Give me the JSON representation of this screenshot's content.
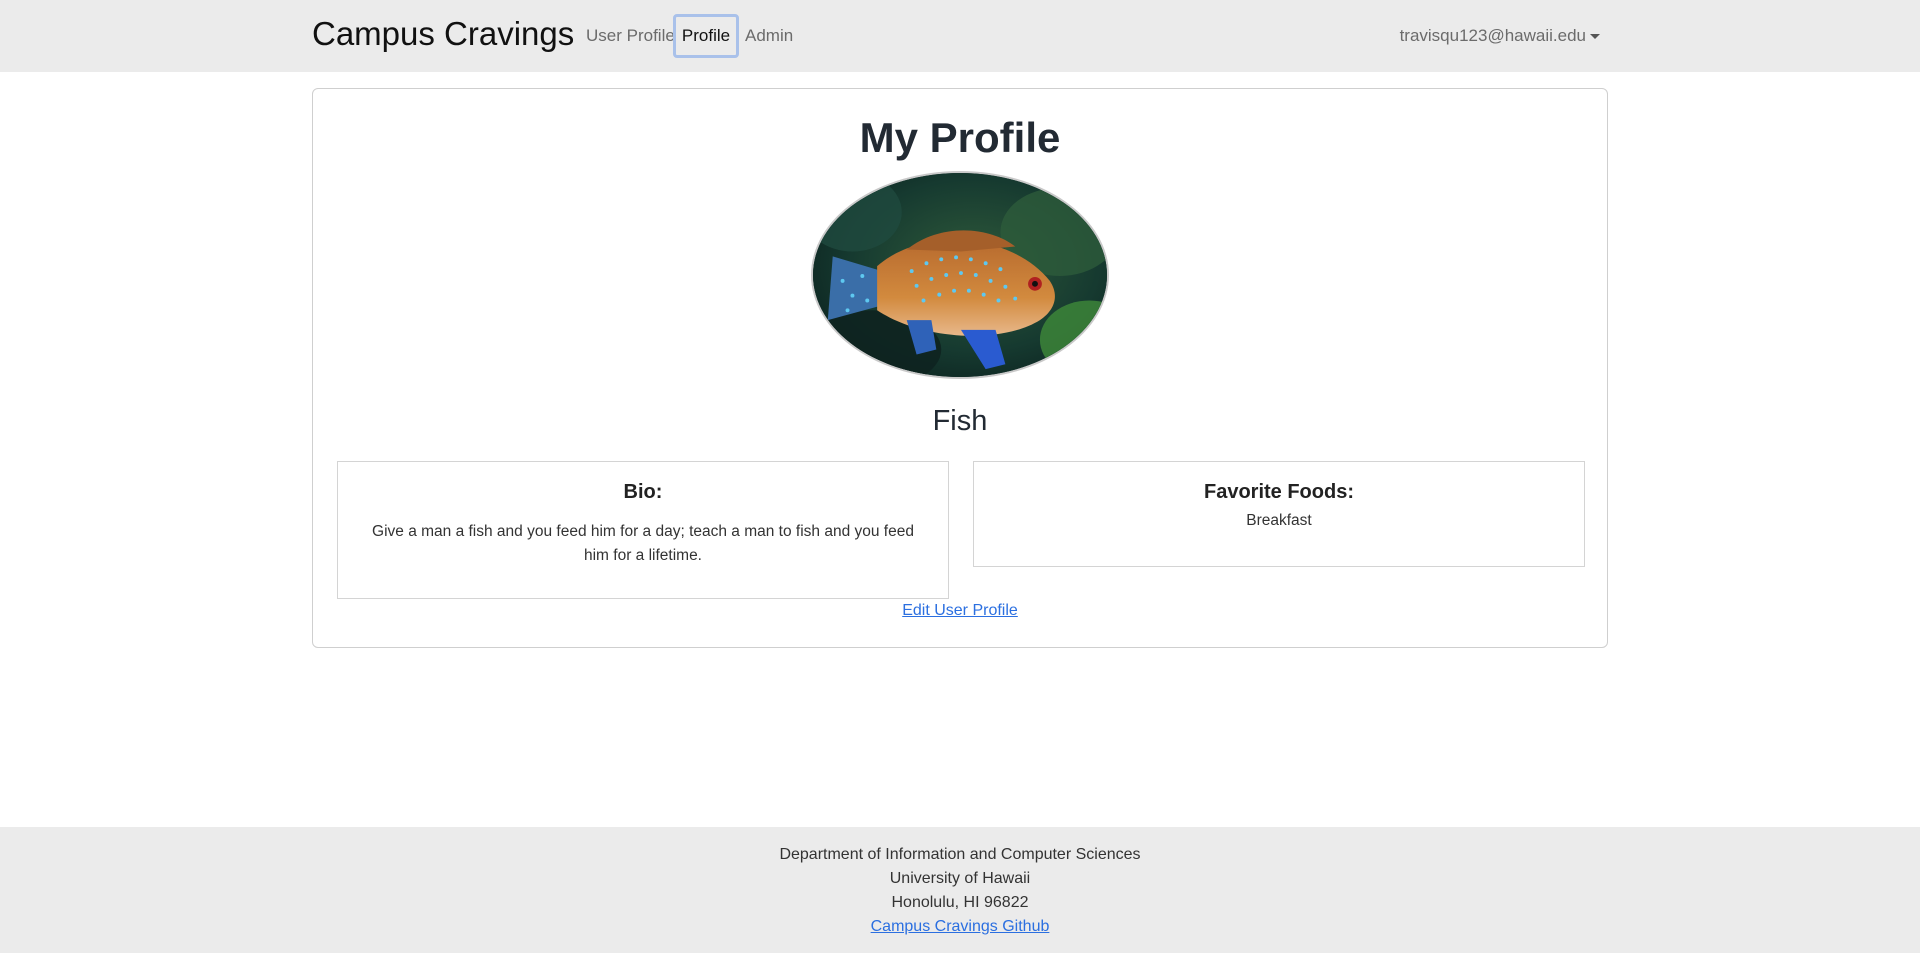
{
  "navbar": {
    "brand": "Campus Cravings",
    "links": [
      {
        "label": "User Profile"
      },
      {
        "label": "Profile"
      },
      {
        "label": "Admin"
      }
    ],
    "user_email": "travisqu123@hawaii.edu"
  },
  "profile": {
    "title": "My Profile",
    "name": "Fish",
    "avatar_icon": "fish-photo",
    "bio_heading": "Bio:",
    "bio_text": "Give a man a fish and you feed him for a day; teach a man to fish and you feed him for a lifetime.",
    "foods_heading": "Favorite Foods:",
    "foods_text": "Breakfast",
    "edit_link": "Edit User Profile"
  },
  "footer": {
    "line1": "Department of Information and Computer Sciences",
    "line2": "University of Hawaii",
    "line3": "Honolulu, HI 96822",
    "github_link": "Campus Cravings Github"
  },
  "colors": {
    "navbar_bg": "#ebebeb",
    "link_blue": "#2b6fe0",
    "active_outline": "#a9c1ea"
  }
}
